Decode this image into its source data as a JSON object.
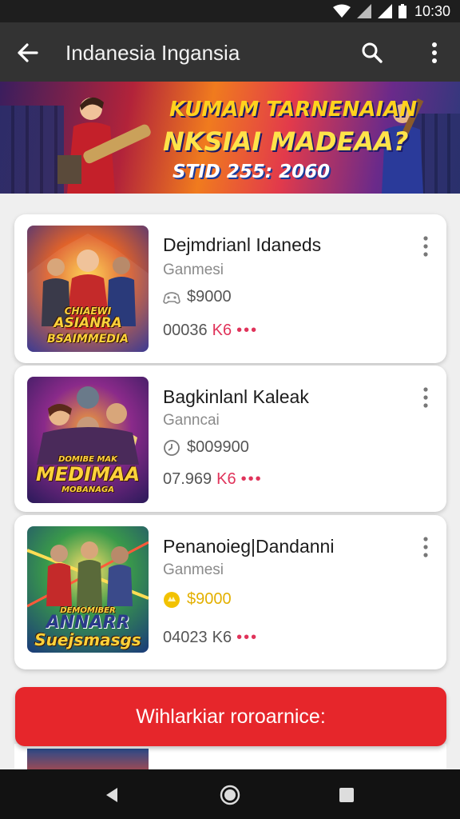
{
  "status": {
    "time": "10:30"
  },
  "app_bar": {
    "title": "Indanesia Ingansia"
  },
  "banner": {
    "line1": "KUMAM TARNENAIAN",
    "line2": "NKSIAI MADEAA?",
    "line3": "STID 255: 2060"
  },
  "games": [
    {
      "title": "Dejmdrianl Idaneds",
      "category": "Ganmesi",
      "price": "$9000",
      "stats": "00036",
      "badge": "K6",
      "thumb_top": "CHIAEWI",
      "thumb_mid": "ASIANRA",
      "thumb_bot": "BSAIMMEDIA"
    },
    {
      "title": "Bagkinlanl Kaleak",
      "category": "Ganncai",
      "price": "$009900",
      "stats": "07.969",
      "badge": "K6",
      "thumb_top": "DOMIBE MAK",
      "thumb_mid": "MEDIMAA",
      "thumb_bot": "MOBANAGA"
    },
    {
      "title": "Penanoieg|Dandanni",
      "category": "Ganmesi",
      "price": "$9000",
      "stats": "04023",
      "badge": "K6",
      "thumb_top": "DEMOMIBER",
      "thumb_mid": "ANNARR",
      "thumb_bot": "Suejsmasgs"
    }
  ],
  "cta": {
    "label": "Wihlarkiar roroarnice:"
  },
  "colors": {
    "accent": "#e6262b",
    "app_bar": "#333333",
    "gold": "#e3b000",
    "badge_red": "#e0335a"
  }
}
